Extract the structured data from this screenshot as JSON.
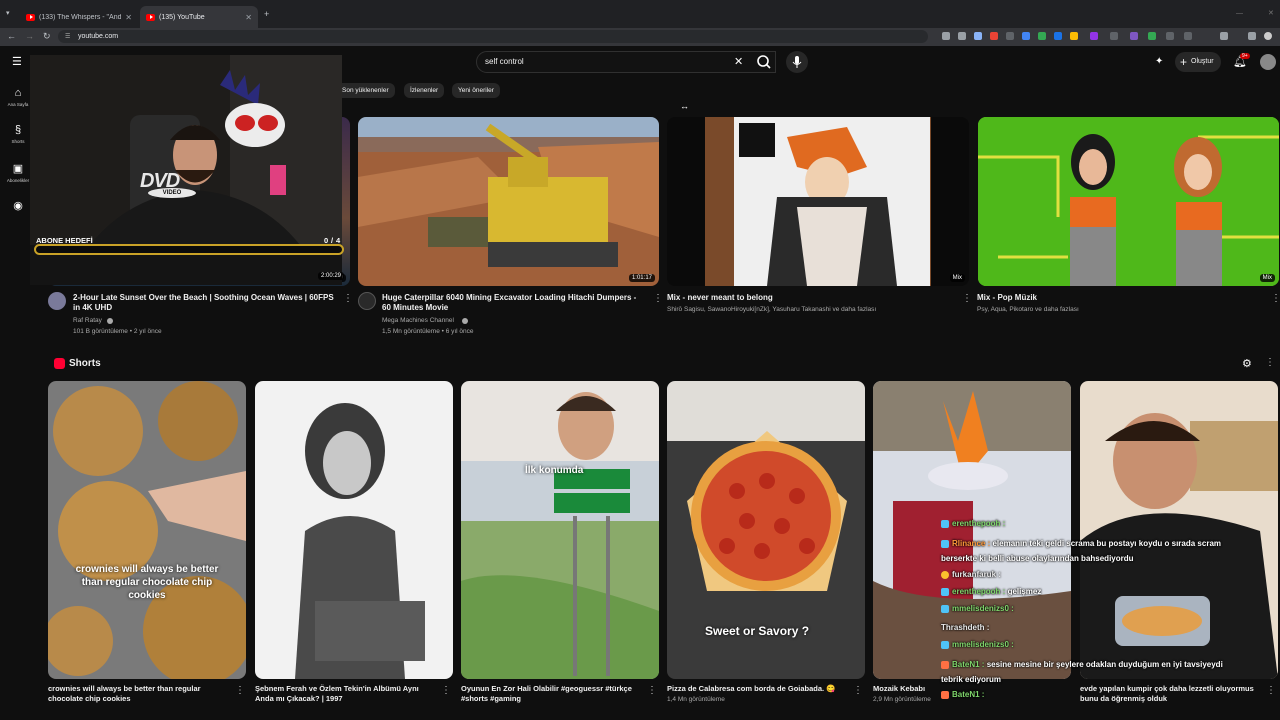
{
  "browser": {
    "tabs": [
      {
        "label": "(133) The Whispers - \"And The"
      },
      {
        "label": "(135) YouTube"
      }
    ],
    "url": "youtube.com"
  },
  "header": {
    "search_value": "self control",
    "create_label": "Oluştur",
    "notif_count": "9+"
  },
  "sidebar": {
    "items": [
      {
        "label": "Ana Sayfa"
      },
      {
        "label": "Shorts"
      },
      {
        "label": "Abonelikler"
      },
      {
        "label": ""
      }
    ]
  },
  "chips": [
    "Son yüklenenler",
    "İzlenenler",
    "Yeni öneriler"
  ],
  "videos": [
    {
      "title": "2-Hour Late Sunset Over the Beach | Soothing Ocean Waves | 60FPS in 4K UHD",
      "channel": "Raf Ratay",
      "meta": "101 B görüntüleme • 2 yıl önce",
      "duration": "2:00:29"
    },
    {
      "title": "Huge Caterpillar 6040 Mining Excavator Loading Hitachi Dumpers - 60 Minutes Movie",
      "channel": "Mega Machines Channel",
      "meta": "1,5 Mn görüntüleme • 6 yıl önce",
      "duration": "1:01:17"
    },
    {
      "title": "Mix - never meant to belong",
      "channel": "Shirō Sagisu, SawanoHiroyuki[nZk], Yasuharu Takanashi ve daha fazlası",
      "meta": "",
      "duration": "Mix"
    },
    {
      "title": "Mix - Pop Müzik",
      "channel": "Psy, Aqua, Pikotaro ve daha fazlası",
      "meta": "",
      "duration": "Mix"
    }
  ],
  "shorts": {
    "heading": "Shorts",
    "items": [
      {
        "title": "crownies will always be better than regular chocolate chip cookies",
        "meta": "",
        "caption": "crownies will always be better than regular chocolate chip cookies"
      },
      {
        "title": "Şebnem Ferah ve Özlem Tekin'in Albümü Aynı Anda mı Çıkacak? | 1997",
        "meta": "",
        "caption": ""
      },
      {
        "title": "Oyunun En Zor Hali Olabilir #geoguessr #türkçe #shorts #gaming",
        "meta": "",
        "caption": "İlk konumda"
      },
      {
        "title": "Pizza de Calabresa com borda de Goiabada. 😋",
        "meta": "1,4 Mn görüntüleme",
        "caption": "Sweet or Savory ?"
      },
      {
        "title": "Mozaik Kebabı",
        "meta": "2,9 Mn görüntüleme",
        "caption": ""
      },
      {
        "title": "evde yapılan kumpir çok daha lezzetli oluyormus bunu da öğrenmiş olduk",
        "meta": "",
        "caption": ""
      }
    ]
  },
  "stream": {
    "goal_label": "ABONE HEDEFİ",
    "goal_current": "0",
    "goal_sep": "/",
    "goal_target": "4",
    "goal_progress": 0,
    "dvd_text": "DVD",
    "dvd_sub": "VIDEO"
  },
  "chat": [
    {
      "user": "erenthepooh :",
      "text": ""
    },
    {
      "user": "Rlinance :",
      "text": "elemanın teki geldi scrama bu postayı koydu o sırada scram berserkte ki belli abuse olaylarından bahsediyordu"
    },
    {
      "user": "furkanfaruk :",
      "text": ""
    },
    {
      "user": "erenthepooh :",
      "text": "gelişmez"
    },
    {
      "user": "mmelisdenizs0 :",
      "text": ""
    },
    {
      "user": "Thrashdeth :",
      "text": ""
    },
    {
      "user": "mmelisdenizs0 :",
      "text": ""
    },
    {
      "user": "BateN1 :",
      "text": "sesine mesine bir şeylere odaklan duyduğum en iyi tavsiyeydi tebrik ediyorum"
    },
    {
      "user": "BateN1 :",
      "text": ""
    }
  ],
  "colors": {
    "bg": "#0f0f0f",
    "accent": "#ff0000",
    "chat_user": "#7fd66b",
    "goal_border": "#c9a227"
  }
}
